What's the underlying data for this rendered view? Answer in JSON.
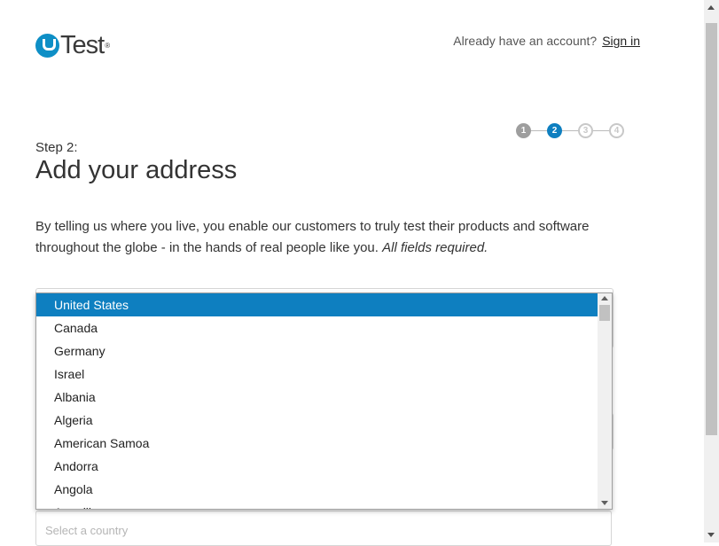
{
  "header": {
    "logo_text": "Test",
    "logo_reg": "®",
    "account_prompt": "Already have an account?",
    "sign_in_label": "Sign in"
  },
  "steps": [
    {
      "label": "1",
      "state": "done"
    },
    {
      "label": "2",
      "state": "active"
    },
    {
      "label": "3",
      "state": "todo"
    },
    {
      "label": "4",
      "state": "todo"
    }
  ],
  "main": {
    "step_label": "Step 2:",
    "title": "Add your address",
    "intro": "By telling us where you live, you enable our customers to truly test their products and software throughout the globe - in the hands of real people like you.",
    "intro_required": "All fields required."
  },
  "country_dropdown": {
    "selected": "United States",
    "options": [
      "United States",
      "Canada",
      "Germany",
      "Israel",
      "Albania",
      "Algeria",
      "American Samoa",
      "Andorra",
      "Angola",
      "Anguilla"
    ]
  },
  "country_select": {
    "placeholder": "Select a country"
  },
  "colors": {
    "brand": "#0e8fc6",
    "selected_option": "#0e7fc0"
  }
}
